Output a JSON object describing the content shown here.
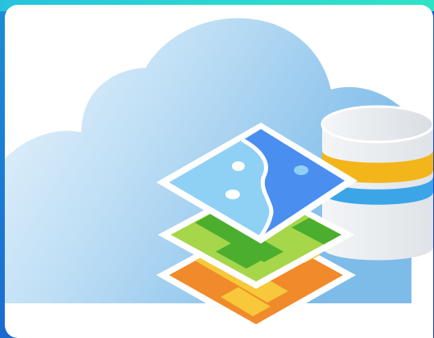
{
  "illustration": {
    "icon": "cloud-map-layers-database-icon",
    "colors": {
      "cloud_light": "#eaf4fc",
      "cloud_mid": "#a9d3f1",
      "cloud_dark": "#6fb2e6",
      "water_blue": "#4a8ef0",
      "water_light": "#8fd0f5",
      "land_green_dark": "#4cae2e",
      "land_green_light": "#a6d64a",
      "land_orange": "#f08a2a",
      "land_yellow": "#f6c83a",
      "db_gold": "#f2b51a",
      "db_blue": "#3ca5e8",
      "db_silver": "#e6eaee"
    }
  }
}
